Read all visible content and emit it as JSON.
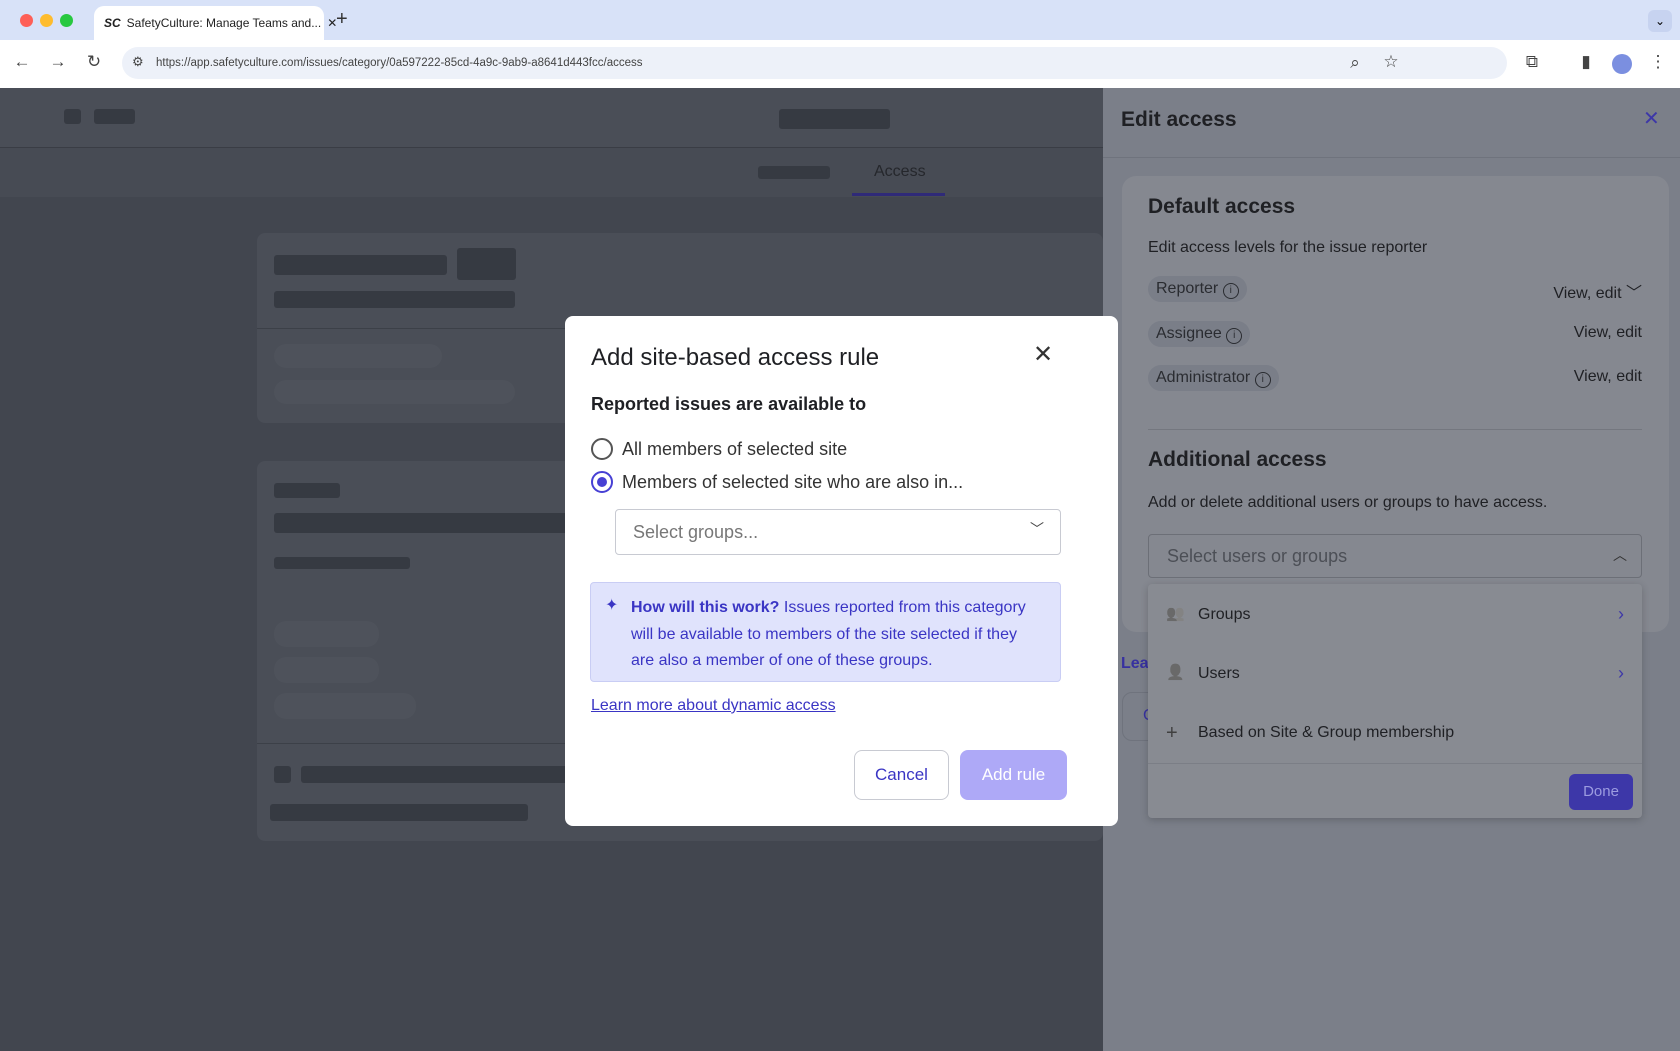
{
  "browser": {
    "tab_title": "SafetyCulture: Manage Teams and...",
    "new_tab": "+",
    "url": "https://app.safetyculture.com/issues/category/0a597222-85cd-4a9c-9ab9-a8641d443fcc/access",
    "favicon": "SC"
  },
  "page": {
    "tab_access": "Access"
  },
  "panel": {
    "title": "Edit access",
    "default_title": "Default access",
    "default_desc": "Edit access levels for the issue reporter",
    "roles": [
      {
        "label": "Reporter",
        "value": "View, edit"
      },
      {
        "label": "Assignee",
        "value": "View, edit"
      },
      {
        "label": "Administrator",
        "value": "View, edit"
      }
    ],
    "additional_title": "Additional access",
    "additional_desc": "Add or delete additional users or groups to have access.",
    "select_placeholder": "Select users or groups",
    "menu": [
      {
        "label": "Groups"
      },
      {
        "label": "Users"
      },
      {
        "label": "Based on Site & Group membership"
      }
    ],
    "done": "Done",
    "link_partial": "Lea",
    "button_partial": "C"
  },
  "modal": {
    "title": "Add site-based access rule",
    "subtitle": "Reported issues are available to",
    "options": [
      {
        "label": "All members of selected site",
        "selected": false
      },
      {
        "label": "Members of selected site who are also in...",
        "selected": true
      }
    ],
    "groups_placeholder": "Select groups...",
    "info_bold": "How will this work?",
    "info_text": " Issues reported from this category will be available to members of the site selected if they are also a member of one of these groups.",
    "learn_more": "Learn more about dynamic access",
    "cancel": "Cancel",
    "add_rule": "Add rule"
  },
  "colors": {
    "accent": "#4740d4",
    "info_bg": "#e0e3fc",
    "disabled": "#aea9f7"
  }
}
